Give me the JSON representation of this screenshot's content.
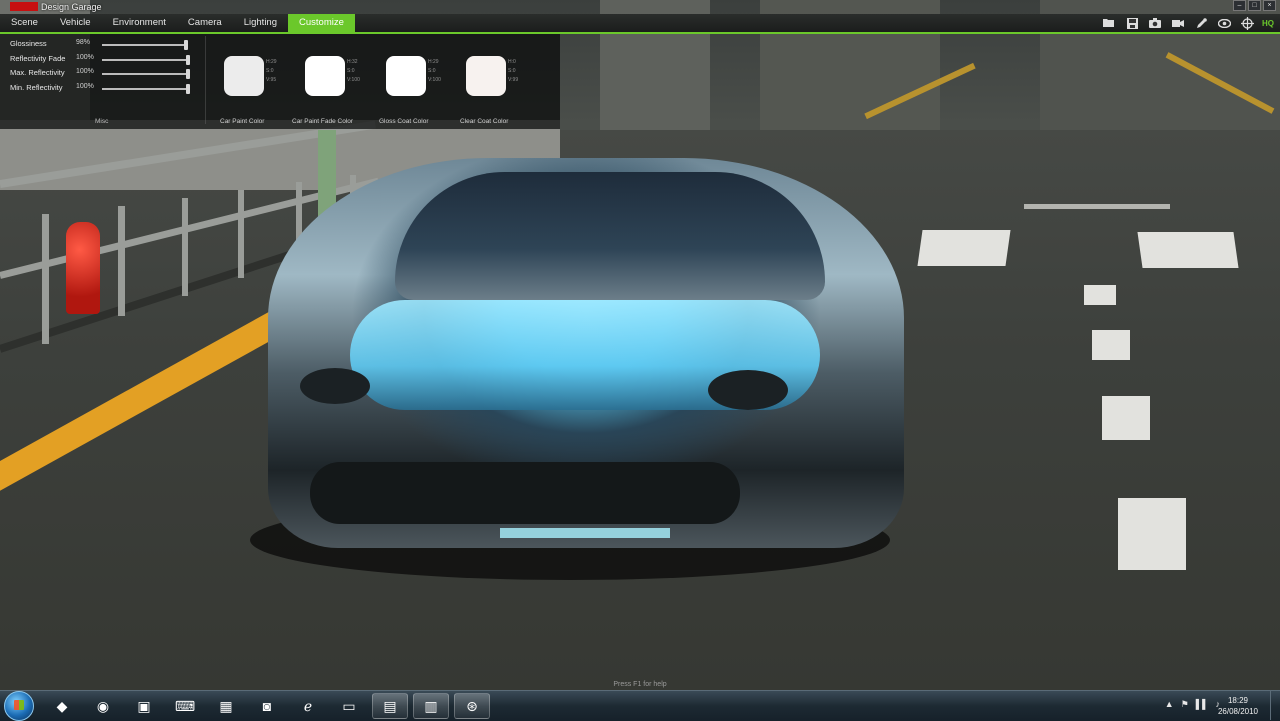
{
  "app": {
    "title": "Design Garage"
  },
  "window_controls": [
    "–",
    "□",
    "×"
  ],
  "menu": {
    "items": [
      "Scene",
      "Vehicle",
      "Environment",
      "Camera",
      "Lighting",
      "Customize"
    ],
    "active": "Customize"
  },
  "toolbar": {
    "icons": [
      "folder-open-icon",
      "save-icon",
      "camera-icon",
      "video-camera-icon",
      "eyedropper-icon",
      "eye-icon",
      "crosshair-icon"
    ],
    "quality_label": "HQ"
  },
  "customize": {
    "sliders": [
      {
        "label": "Glossiness",
        "value": "98%",
        "level": 0.98
      },
      {
        "label": "Reflectivity Fade",
        "value": "100%",
        "level": 1.0
      },
      {
        "label": "Max. Reflectivity",
        "value": "100%",
        "level": 1.0
      },
      {
        "label": "Min. Reflectivity",
        "value": "100%",
        "level": 1.0
      }
    ],
    "misc_label": "Misc",
    "swatches": [
      {
        "caption": "Car Paint Color",
        "color": "#ececec",
        "h": "H:29",
        "s": "S:0",
        "v": "V:95"
      },
      {
        "caption": "Car Paint Fade Color",
        "color": "#ffffff",
        "h": "H:32",
        "s": "S:0",
        "v": "V:100"
      },
      {
        "caption": "Gloss Coat Color",
        "color": "#ffffff",
        "h": "H:29",
        "s": "S:0",
        "v": "V:100"
      },
      {
        "caption": "Clear Coat Color",
        "color": "#f7f2ef",
        "h": "H:0",
        "s": "S:0",
        "v": "V:99"
      }
    ]
  },
  "help_hint": "Press F1 for help",
  "taskbar": {
    "apps": [
      {
        "name": "darth-vader-icon",
        "glyph": "◆",
        "open": false
      },
      {
        "name": "globe-icon",
        "glyph": "◉",
        "open": false
      },
      {
        "name": "padlock-icon",
        "glyph": "▣",
        "open": false
      },
      {
        "name": "keyboard-icon",
        "glyph": "⌨",
        "open": false
      },
      {
        "name": "controlpanel-icon",
        "glyph": "▦",
        "open": false
      },
      {
        "name": "messenger-icon",
        "glyph": "◙",
        "open": false
      },
      {
        "name": "internet-explorer-icon",
        "glyph": "ℯ",
        "open": false
      },
      {
        "name": "folder-icon",
        "glyph": "▭",
        "open": false
      },
      {
        "name": "monitor-icon",
        "glyph": "▤",
        "open": true
      },
      {
        "name": "gpu-icon",
        "glyph": "▥",
        "open": true
      },
      {
        "name": "steering-wheel-icon",
        "glyph": "⊛",
        "open": true
      }
    ],
    "tray_icons": [
      "▲",
      "⚑",
      "▌▌",
      "♪"
    ],
    "time": "18:29",
    "date": "26/08/2010"
  }
}
